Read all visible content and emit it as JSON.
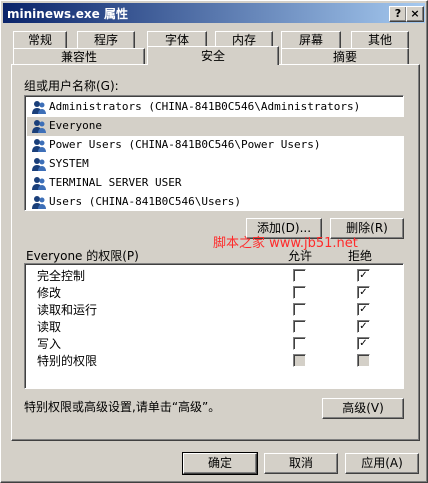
{
  "window": {
    "title": "mininews.exe 属性",
    "help_btn": "?",
    "close_btn": "×"
  },
  "tabs_row1": [
    "常规",
    "程序",
    "字体",
    "内存",
    "屏幕",
    "其他"
  ],
  "tabs_row2": [
    "兼容性",
    "安全",
    "摘要"
  ],
  "active_tab": "安全",
  "groups": {
    "label": "组或用户名称(G):",
    "items": [
      "Administrators (CHINA-841B0C546\\Administrators)",
      "Everyone",
      "Power Users (CHINA-841B0C546\\Power Users)",
      "SYSTEM",
      "TERMINAL SERVER USER",
      "Users (CHINA-841B0C546\\Users)"
    ],
    "selected": "Everyone"
  },
  "buttons": {
    "add": "添加(D)...",
    "remove": "删除(R)",
    "advanced": "高级(V)",
    "ok": "确定",
    "cancel": "取消",
    "apply": "应用(A)"
  },
  "watermark": "脚本之家 www.jb51.net",
  "permissions": {
    "label": "Everyone 的权限(P)",
    "allow_header": "允许",
    "deny_header": "拒绝",
    "rows": [
      {
        "name": "完全控制",
        "allow": false,
        "deny": true,
        "disabled": false
      },
      {
        "name": "修改",
        "allow": false,
        "deny": true,
        "disabled": false
      },
      {
        "name": "读取和运行",
        "allow": false,
        "deny": true,
        "disabled": false
      },
      {
        "name": "读取",
        "allow": false,
        "deny": true,
        "disabled": false
      },
      {
        "name": "写入",
        "allow": false,
        "deny": true,
        "disabled": false
      },
      {
        "name": "特别的权限",
        "allow": false,
        "deny": false,
        "disabled": true
      }
    ]
  },
  "advanced_note": "特别权限或高级设置,请单击“高级”。"
}
